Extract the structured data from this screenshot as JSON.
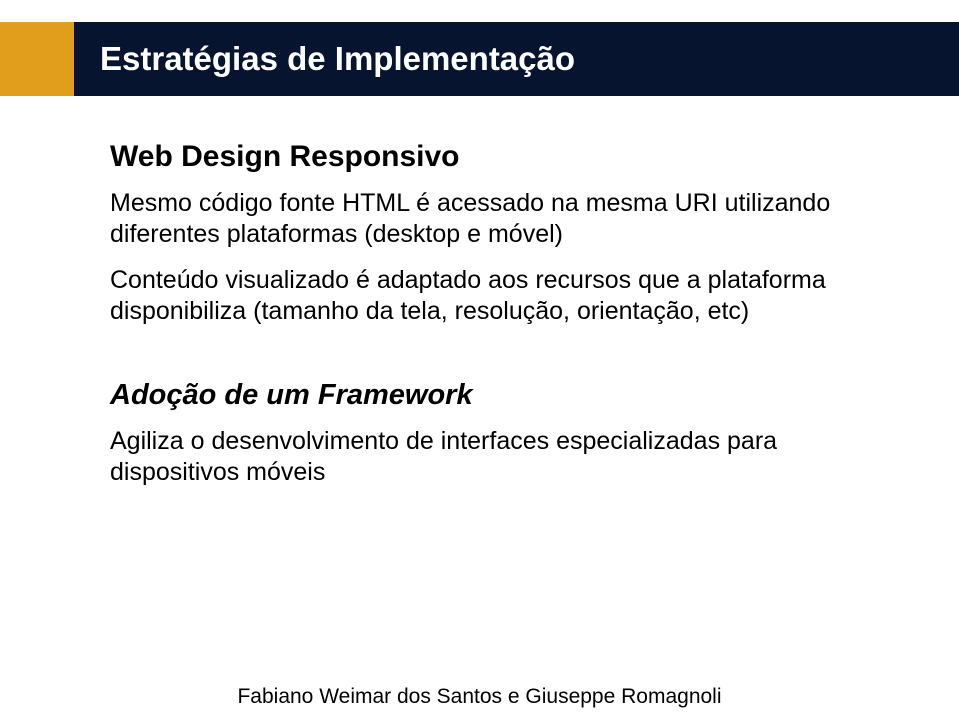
{
  "header": {
    "title": "Estratégias de Implementação"
  },
  "section1": {
    "heading": "Web Design Responsivo",
    "para1": "Mesmo código fonte HTML é acessado na mesma  URI utilizando diferentes plataformas (desktop e móvel)",
    "para2": "Conteúdo visualizado é adaptado aos recursos que a plataforma disponibiliza (tamanho da tela, resolução, orientação, etc)"
  },
  "section2": {
    "heading": "Adoção de um Framework",
    "para1": "Agiliza o desenvolvimento de interfaces especializadas para dispositivos móveis"
  },
  "footer": {
    "text": "Fabiano Weimar dos Santos e Giuseppe Romagnoli"
  }
}
